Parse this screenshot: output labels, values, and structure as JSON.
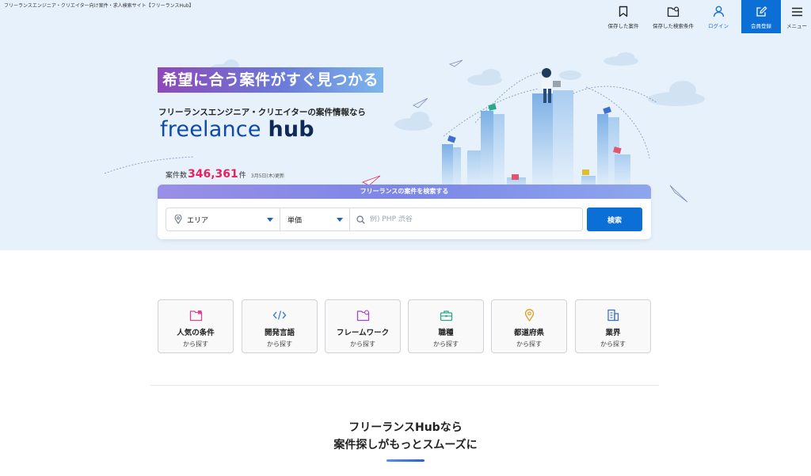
{
  "site_tag": "フリーランスエンジニア・クリエイター向け案件・求人検索サイト【フリーランスHub】",
  "header": {
    "saved_jobs": "保存した案件",
    "saved_searches": "保存した検索条件",
    "login": "ログイン",
    "signup": "会員登録",
    "menu": "メニュー",
    "icons": [
      "bookmark-icon",
      "folder-plus-icon",
      "user-icon",
      "edit-icon",
      "hamburger-icon"
    ]
  },
  "hero": {
    "catch": "希望に合う案件がすぐ見つかる",
    "subcatch": "フリーランスエンジニア・クリエイターの案件情報なら",
    "logo_main": "freelance",
    "logo_hub": "hub",
    "count_prefix": "案件数",
    "count_value": "346,361",
    "count_suffix": "件",
    "updated": "3月5日(木)更新"
  },
  "search": {
    "title": "フリーランスの案件を検索する",
    "area_label": "エリア",
    "price_label": "単価",
    "keyword_placeholder": "例) PHP 渋谷",
    "button": "検索"
  },
  "categories": [
    {
      "title": "人気の条件",
      "sub": "から探す",
      "icon": "star-folder-icon",
      "color": "#d9468f"
    },
    {
      "title": "開発言語",
      "sub": "から探す",
      "icon": "code-icon",
      "color": "#3c7fd9"
    },
    {
      "title": "フレームワーク",
      "sub": "から探す",
      "icon": "framework-folder-icon",
      "color": "#a546c9"
    },
    {
      "title": "職種",
      "sub": "から探す",
      "icon": "briefcase-icon",
      "color": "#2aa88a"
    },
    {
      "title": "都道府県",
      "sub": "から探す",
      "icon": "map-pin-icon",
      "color": "#e0a02a"
    },
    {
      "title": "業界",
      "sub": "から探す",
      "icon": "building-icon",
      "color": "#3c6fd0"
    }
  ],
  "lead": {
    "line1": "フリーランスHubなら",
    "line2": "案件探しがもっとスムーズに"
  },
  "colors": {
    "accent": "#0b6fd6",
    "hero_bg": "#e6f1fb",
    "count": "#e3245f"
  }
}
